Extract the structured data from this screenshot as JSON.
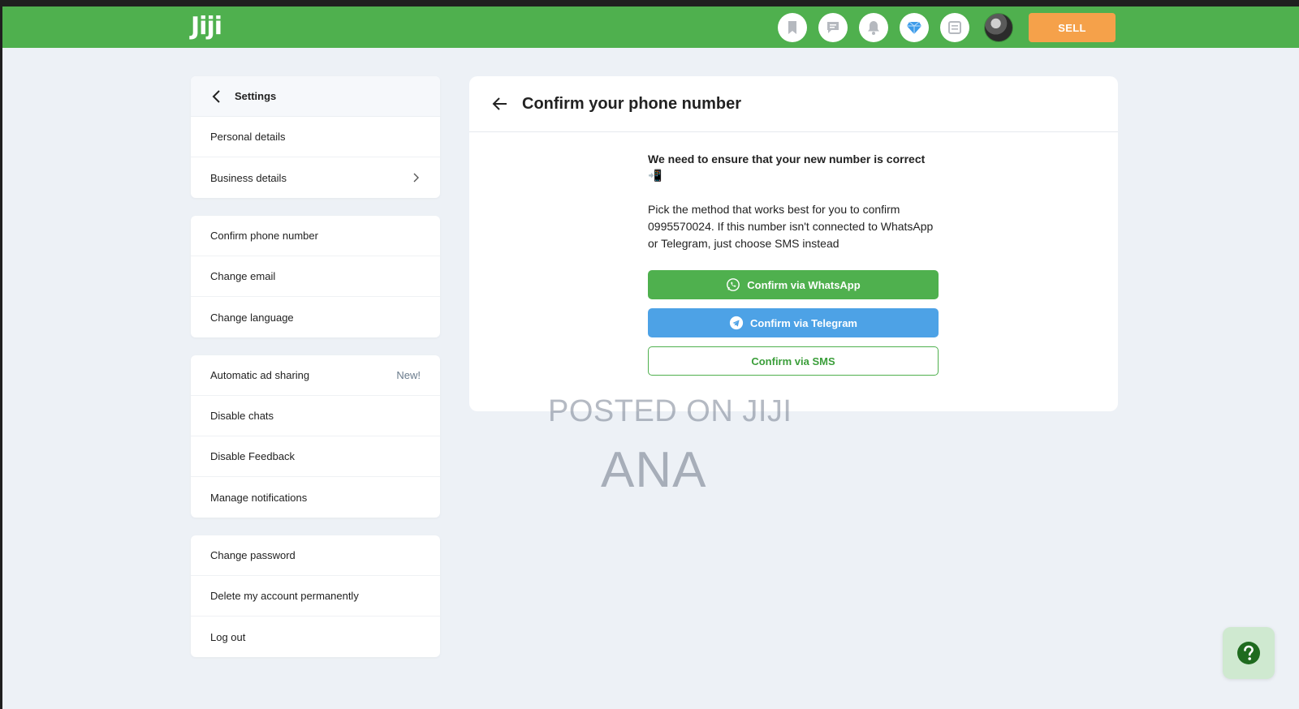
{
  "header": {
    "logo": "Jiji",
    "icons": [
      "bookmark-icon",
      "chat-icon",
      "bell-icon",
      "diamond-icon",
      "list-icon"
    ],
    "sell_label": "SELL"
  },
  "sidebar": {
    "title": "Settings",
    "groups": [
      {
        "items": [
          {
            "label": "Personal details"
          },
          {
            "label": "Business details"
          }
        ]
      },
      {
        "items": [
          {
            "label": "Confirm phone number"
          },
          {
            "label": "Change email"
          },
          {
            "label": "Change language"
          }
        ]
      },
      {
        "items": [
          {
            "label": "Automatic ad sharing",
            "badge": "New!"
          },
          {
            "label": "Disable chats"
          },
          {
            "label": "Disable Feedback"
          },
          {
            "label": "Manage notifications"
          }
        ]
      },
      {
        "items": [
          {
            "label": "Change password"
          },
          {
            "label": "Delete my account permanently"
          },
          {
            "label": "Log out"
          }
        ]
      }
    ]
  },
  "main": {
    "title": "Confirm your phone number",
    "lead": "We need to ensure that your new number is correct 📲",
    "description": "Pick the method that works best for you to confirm 0995570024. If this number isn't connected to WhatsApp or Telegram, just choose SMS instead",
    "buttons": {
      "whatsapp": "Confirm via WhatsApp",
      "telegram": "Confirm via Telegram",
      "sms": "Confirm via SMS"
    }
  },
  "watermark": {
    "line1": "POSTED ON JIJI",
    "line2": "ANA"
  },
  "colors": {
    "brand_green": "#4fb04e",
    "sell_orange": "#f5a14a",
    "telegram_blue": "#4da2e6"
  }
}
